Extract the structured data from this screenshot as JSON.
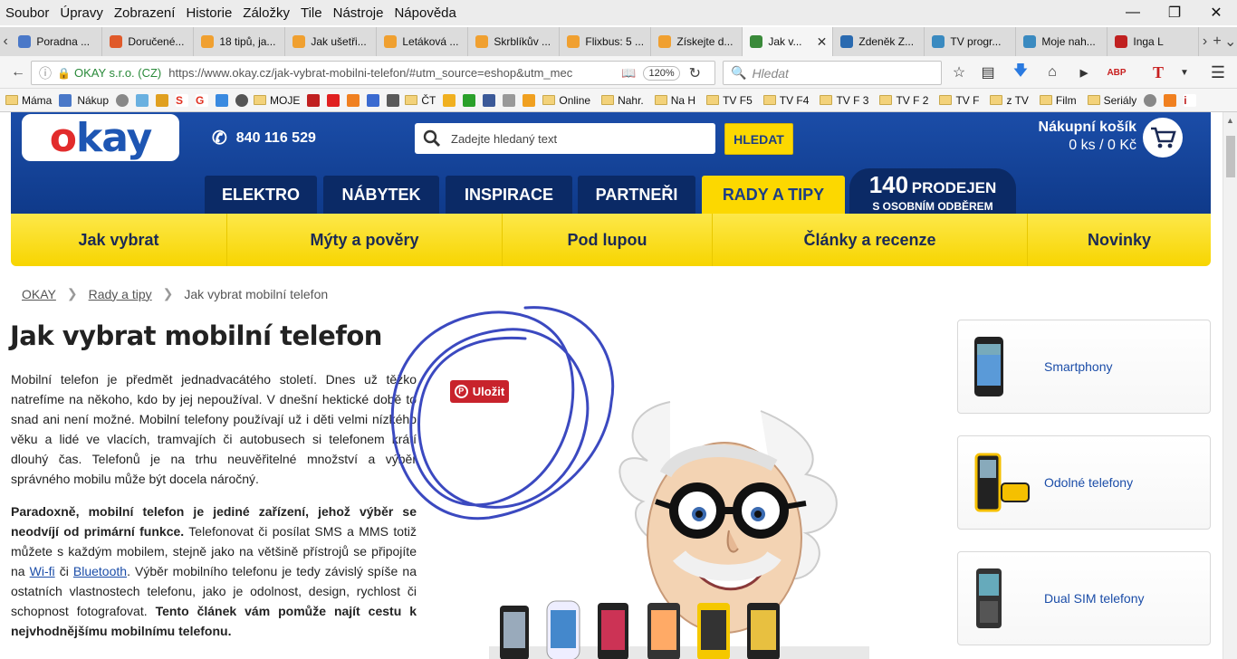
{
  "menubar": {
    "items": [
      "Soubor",
      "Úpravy",
      "Zobrazení",
      "Historie",
      "Záložky",
      "Tile",
      "Nástroje",
      "Nápověda"
    ]
  },
  "tabs": [
    {
      "label": "Poradna ...",
      "color": "#4a78c8"
    },
    {
      "label": "Doručené...",
      "color": "#e05a2a"
    },
    {
      "label": "18 tipů, ja...",
      "color": "#f0a030"
    },
    {
      "label": "Jak ušetři...",
      "color": "#f0a030"
    },
    {
      "label": "Letáková ...",
      "color": "#f0a030"
    },
    {
      "label": "Skrblíkův ...",
      "color": "#f0a030"
    },
    {
      "label": "Flixbus: 5 ...",
      "color": "#f0a030"
    },
    {
      "label": "Získejte d...",
      "color": "#f0a030"
    },
    {
      "label": "Jak v...",
      "color": "#3a8a3a",
      "active": true
    },
    {
      "label": "Zdeněk Z...",
      "color": "#2a6ab0"
    },
    {
      "label": "TV progr...",
      "color": "#3a8ac0"
    },
    {
      "label": "Moje nah...",
      "color": "#3a8ac0"
    },
    {
      "label": "Inga L",
      "color": "#c02020"
    }
  ],
  "nav": {
    "site_identity": "OKAY s.r.o. (CZ)",
    "url": "https://www.okay.cz/jak-vybrat-mobilni-telefon/#utm_source=eshop&utm_mec",
    "zoom": "120%",
    "search_placeholder": "Hledat"
  },
  "bookmarks": [
    "Máma",
    "Nákup",
    "MOJE",
    "ČT",
    "Online",
    "Nahr.",
    "Na H",
    "TV F5",
    "TV F4",
    "TV F 3",
    "TV F 2",
    "TV F",
    "z TV",
    "Film",
    "Seriály"
  ],
  "site": {
    "logo": "okay",
    "phone": "840 116 529",
    "search_placeholder": "Zadejte hledaný text",
    "search_button": "HLEDAT",
    "cart_title": "Nákupní košík",
    "cart_summary": "0 ks / 0 Kč",
    "main_tabs": [
      "ELEKTRO",
      "NÁBYTEK",
      "INSPIRACE",
      "PARTNEŘI",
      "RADY A TIPY"
    ],
    "prodejen_num": "140",
    "prodejen_word": "PRODEJEN",
    "prodejen_sub": "S OSOBNÍM ODBĚREM",
    "subnav": [
      "Jak vybrat",
      "Mýty a pověry",
      "Pod lupou",
      "Články a recenze",
      "Novinky"
    ]
  },
  "breadcrumb": [
    "OKAY",
    "Rady a tipy",
    "Jak vybrat mobilní telefon"
  ],
  "article": {
    "title": "Jak vybrat mobilní telefon",
    "p1": "Mobilní telefon je předmět jednadvacátého století. Dnes už těžko natrefíme na někoho, kdo by jej nepoužíval. V dnešní hektické době to snad ani není možné. Mobilní telefony používají už i děti velmi nízkého věku a lidé ve vlacích, tramvajích či autobusech si telefonem krátí dlouhý čas. Telefonů je na trhu neuvěřitelné množství a výběr správného mobilu může být docela náročný.",
    "p2_bold": "Paradoxně, mobilní telefon je jediné zařízení, jehož výběr se neodvíjí od primární funkce.",
    "p2_a": " Telefonovat či posílat SMS a MMS totiž můžete s každým mobilem, stejně jako na většině přístrojů se připojíte na ",
    "p2_link1": "Wi-fi",
    "p2_mid": " či ",
    "p2_link2": "Bluetooth",
    "p2_b": ". Výběr mobilního telefonu je tedy závislý spíše na ostatních vlastnostech telefonu, jako je odolnost, design, rychlost či schopnost fotografovat. ",
    "p2_bold2": "Tento článek vám pomůže najít cestu k nejvhodnějšímu mobilnímu telefonu.",
    "pin_label": "Uložit"
  },
  "side_cards": [
    "Smartphony",
    "Odolné telefony",
    "Dual SIM telefony"
  ],
  "colors": {
    "brand_blue": "#1b4da8",
    "brand_yellow": "#fcd800",
    "pinterest": "#c8232c",
    "scribble": "#3b49c0"
  }
}
